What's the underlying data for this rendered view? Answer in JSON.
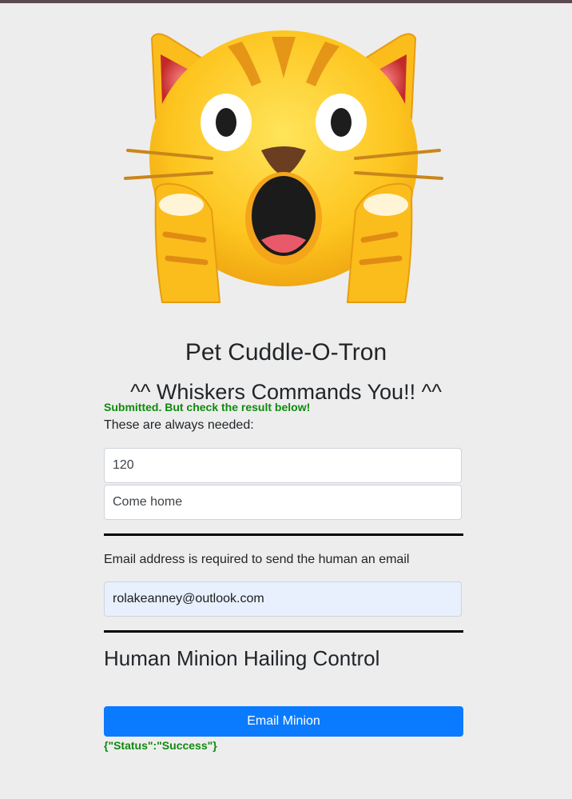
{
  "app": {
    "title": "Pet Cuddle-O-Tron",
    "subtitle": "^^ Whiskers Commands You!! ^^"
  },
  "mascot": {
    "icon": "shocked-cat-face-icon",
    "alt": "shocked cat emoji"
  },
  "form": {
    "status_message": "Submitted. But check the result below!",
    "required_hint": "These are always needed:",
    "fields": {
      "first": {
        "value": "120"
      },
      "second": {
        "value": "Come home"
      }
    },
    "email_hint": "Email address is required to send the human an email",
    "email": {
      "value": "rolakeanney@outlook.com"
    }
  },
  "control": {
    "heading": "Human Minion Hailing Control",
    "button_label": "Email Minion",
    "result_text": "{\"Status\":\"Success\"}"
  },
  "colors": {
    "background": "#ededed",
    "primary_button": "#0a7bff",
    "success_text": "#0f8a0f",
    "autofill_bg": "#e8f0fe"
  }
}
